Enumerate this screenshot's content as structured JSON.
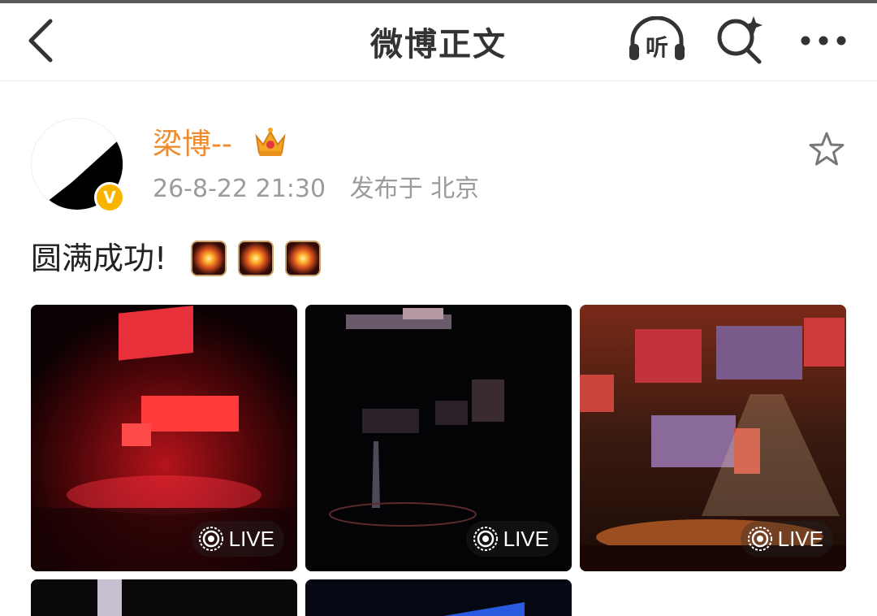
{
  "header": {
    "title": "微博正文",
    "listen_label": "听"
  },
  "post": {
    "username": "梁博--",
    "verified_badge": "V",
    "time": "26-8-22 21:30",
    "location": "发布于 北京",
    "text": "圆满成功!",
    "emoji_count": 3
  },
  "photos": [
    {
      "live_label": "LIVE",
      "theme": "red-stage"
    },
    {
      "live_label": "LIVE",
      "theme": "dark-stage"
    },
    {
      "live_label": "LIVE",
      "theme": "orange-stage"
    },
    {
      "theme": "partial"
    },
    {
      "theme": "partial-blue"
    }
  ],
  "colors": {
    "username": "#f08a2c",
    "meta": "#9b9b9b",
    "verified": "#f7b500"
  }
}
